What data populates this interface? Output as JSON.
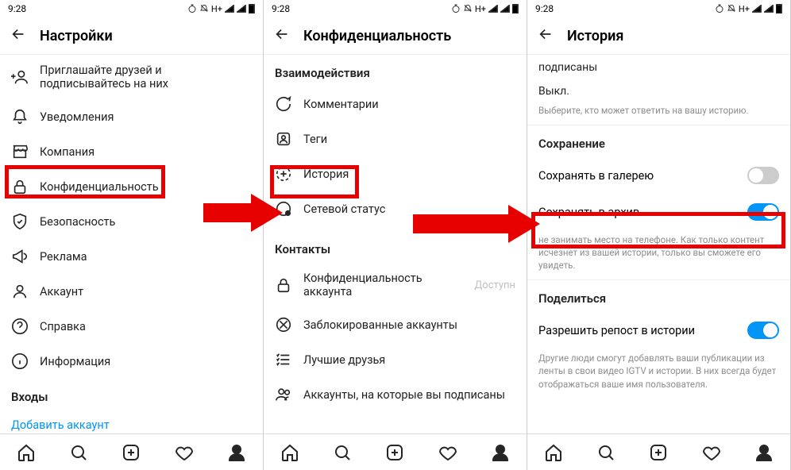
{
  "status": {
    "time": "9:28",
    "network": "H+"
  },
  "panel1": {
    "title": "Настройки",
    "items": [
      {
        "label": "Приглашайте друзей и подписывайтесь на них"
      },
      {
        "label": "Уведомления"
      },
      {
        "label": "Компания"
      },
      {
        "label": "Конфиденциальность"
      },
      {
        "label": "Безопасность"
      },
      {
        "label": "Реклама"
      },
      {
        "label": "Аккаунт"
      },
      {
        "label": "Справка"
      },
      {
        "label": "Информация"
      }
    ],
    "logins_header": "Входы",
    "add_account": "Добавить аккаунт"
  },
  "panel2": {
    "title": "Конфиденциальность",
    "section_interactions": "Взаимодействия",
    "items_a": [
      {
        "label": "Комментарии"
      },
      {
        "label": "Теги"
      },
      {
        "label": "История"
      },
      {
        "label": "Сетевой статус"
      }
    ],
    "section_contacts": "Контакты",
    "items_b": [
      {
        "label": "Конфиденциальность аккаунта",
        "trailing": "Доступн"
      },
      {
        "label": "Заблокированные аккаунты"
      },
      {
        "label": "Лучшие друзья"
      },
      {
        "label": "Аккаунты, на которые вы подписаны"
      }
    ]
  },
  "panel3": {
    "title": "История",
    "subscribed": "подписаны",
    "off": "Выкл.",
    "reply_hint": "Выберите, кто может ответить на вашу историю.",
    "section_save": "Сохранение",
    "save_gallery": "Сохранять в галерею",
    "save_archive": "Сохранять в архив",
    "archive_hint": "не занимать место на телефоне. Как только контент исчезнет из вашей истории, только вы сможете его увидеть.",
    "section_share": "Поделиться",
    "allow_repost": "Разрешить репост в истории",
    "repost_hint": "Другие люди смогут добавлять ваши публикации из ленты в свои видео IGTV и истории. В них всегда будет отображаться ваше имя пользователя."
  }
}
